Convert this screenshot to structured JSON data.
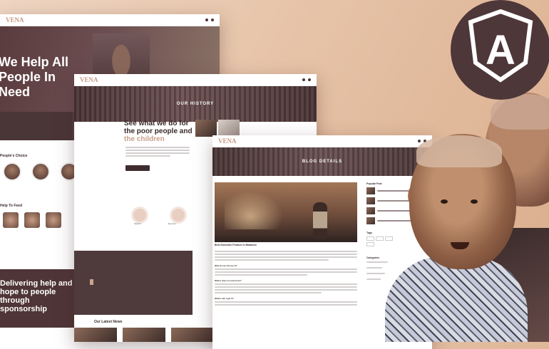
{
  "brand": {
    "logo_prefix": "V",
    "logo_accent": "ENA",
    "angular_letter": "A",
    "colors": {
      "primary": "#4f3a3c",
      "accent": "#c7a08c",
      "badge": "#4e3739"
    }
  },
  "screen1": {
    "hero_title": "We Help All People In Need",
    "section_people": "People's Choice",
    "section_feed": "Help To Feed",
    "band_title": "Delivering help and hope to people through sponsorship"
  },
  "screen2": {
    "hero_title": "OUR HISTORY",
    "headline_main": "See what we do for the poor people and ",
    "headline_accent": "the children",
    "icon_labels": [
      "Search",
      "Sponsor"
    ],
    "latest_news": "Our Latest News"
  },
  "screen3": {
    "hero_title": "BLOG DETAILS",
    "post_title": "Best Domestic Product in Mtwahoo",
    "sidebar_popular": "Popular Post",
    "sidebar_tags": "Tags",
    "sidebar_categories": "Categories",
    "questions": [
      "Why do we choose it?",
      "Where does it come from?",
      "Where can I get it?"
    ]
  }
}
